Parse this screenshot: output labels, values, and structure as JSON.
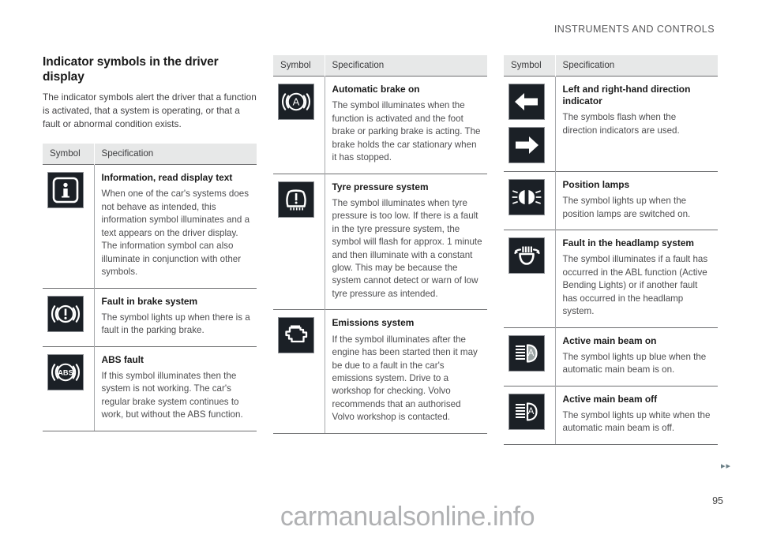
{
  "header": {
    "running_head": "INSTRUMENTS AND CONTROLS"
  },
  "intro": {
    "title": "Indicator symbols in the driver display",
    "body": "The indicator symbols alert the driver that a function is activated, that a system is operating, or that a fault or abnormal condition exists."
  },
  "table_headers": {
    "symbol": "Symbol",
    "specification": "Specification"
  },
  "columns": [
    {
      "id": "column-1",
      "rows": [
        {
          "icons": [
            "information-symbol-icon"
          ],
          "title": "Information, read display text",
          "body": "When one of the car's systems does not behave as intended, this information symbol illuminates and a text appears on the driver display. The information symbol can also illuminate in conjunction with other symbols."
        },
        {
          "icons": [
            "brake-system-fault-icon"
          ],
          "title": "Fault in brake system",
          "body": "The symbol lights up when there is a fault in the parking brake."
        },
        {
          "icons": [
            "abs-fault-icon"
          ],
          "title": "ABS fault",
          "body": "If this symbol illuminates then the system is not working. The car's regular brake system continues to work, but without the ABS function."
        }
      ]
    },
    {
      "id": "column-2",
      "rows": [
        {
          "icons": [
            "automatic-brake-icon"
          ],
          "title": "Automatic brake on",
          "body": "The symbol illuminates when the function is activated and the foot brake or parking brake is acting. The brake holds the car stationary when it has stopped."
        },
        {
          "icons": [
            "tyre-pressure-icon"
          ],
          "title": "Tyre pressure system",
          "body": "The symbol illuminates when tyre pressure is too low. If there is a fault in the tyre pressure system, the symbol will flash for approx. 1 minute and then illuminate with a constant glow. This may be because the system cannot detect or warn of low tyre pressure as intended."
        },
        {
          "icons": [
            "emissions-system-icon"
          ],
          "title": "Emissions system",
          "body": "If the symbol illuminates after the engine has been started then it may be due to a fault in the car's emissions system. Drive to a workshop for checking. Volvo recommends that an authorised Volvo workshop is contacted."
        }
      ]
    },
    {
      "id": "column-3",
      "rows": [
        {
          "icons": [
            "direction-indicator-left-icon",
            "direction-indicator-right-icon"
          ],
          "title": "Left and right-hand direction indicator",
          "body": "The symbols flash when the direction indicators are used."
        },
        {
          "icons": [
            "position-lamps-icon"
          ],
          "title": "Position lamps",
          "body": "The symbol lights up when the position lamps are switched on."
        },
        {
          "icons": [
            "headlamp-system-fault-icon"
          ],
          "title": "Fault in the headlamp system",
          "body": "The symbol illuminates if a fault has occurred in the ABL function (Active Bending Lights) or if another fault has occurred in the headlamp system."
        },
        {
          "icons": [
            "active-main-beam-on-icon"
          ],
          "title": "Active main beam on",
          "body": "The symbol lights up blue when the automatic main beam is on."
        },
        {
          "icons": [
            "active-main-beam-off-icon"
          ],
          "title": "Active main beam off",
          "body": "The symbol lights up white when the automatic main beam is off."
        }
      ]
    }
  ],
  "footer": {
    "next_arrows": "▸▸",
    "page_number": "95",
    "watermark": "carmanualsonline.info"
  },
  "colors": {
    "icon_background": "#1b2026",
    "icon_foreground": "#ffffff",
    "table_header_background": "#e7e8e8",
    "rule": "#6d6e70"
  }
}
